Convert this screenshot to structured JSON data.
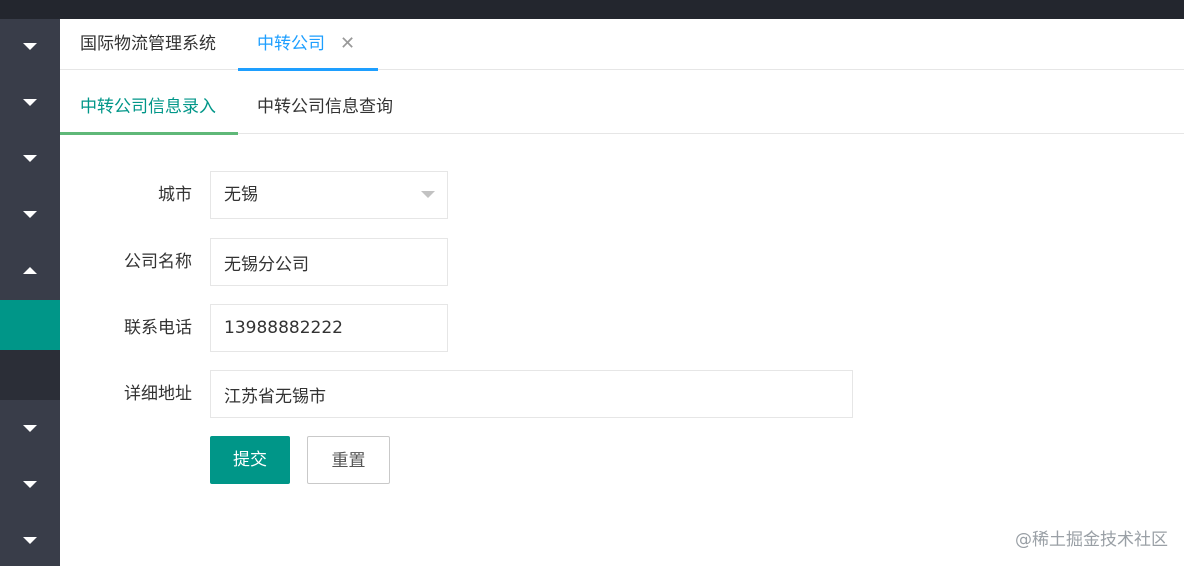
{
  "app": {
    "title": "国际物流管理系统"
  },
  "tabs": {
    "home_label": "国际物流管理系统",
    "active_label": "中转公司",
    "close_symbol": "✕"
  },
  "subtabs": {
    "entry_label": "中转公司信息录入",
    "query_label": "中转公司信息查询"
  },
  "form": {
    "city_label": "城市",
    "city_value": "无锡",
    "company_label": "公司名称",
    "company_value": "无锡分公司",
    "phone_label": "联系电话",
    "phone_value": "13988882222",
    "address_label": "详细地址",
    "address_value": "江苏省无锡市"
  },
  "buttons": {
    "submit_label": "提交",
    "reset_label": "重置"
  },
  "watermark": "@稀土掘金技术社区",
  "colors": {
    "topbar": "#23262e",
    "sidebar": "#393d49",
    "sidebar_active": "#009688",
    "tab_active": "#1e9fff",
    "subtab_active": "#009688",
    "subtab_underline": "#5fb878",
    "submit_button": "#009688"
  },
  "icons": {
    "sidebar_expand": "chevron-down-icon",
    "sidebar_collapse": "chevron-up-icon",
    "select_caret": "caret-down-icon",
    "tab_close": "close-icon"
  }
}
